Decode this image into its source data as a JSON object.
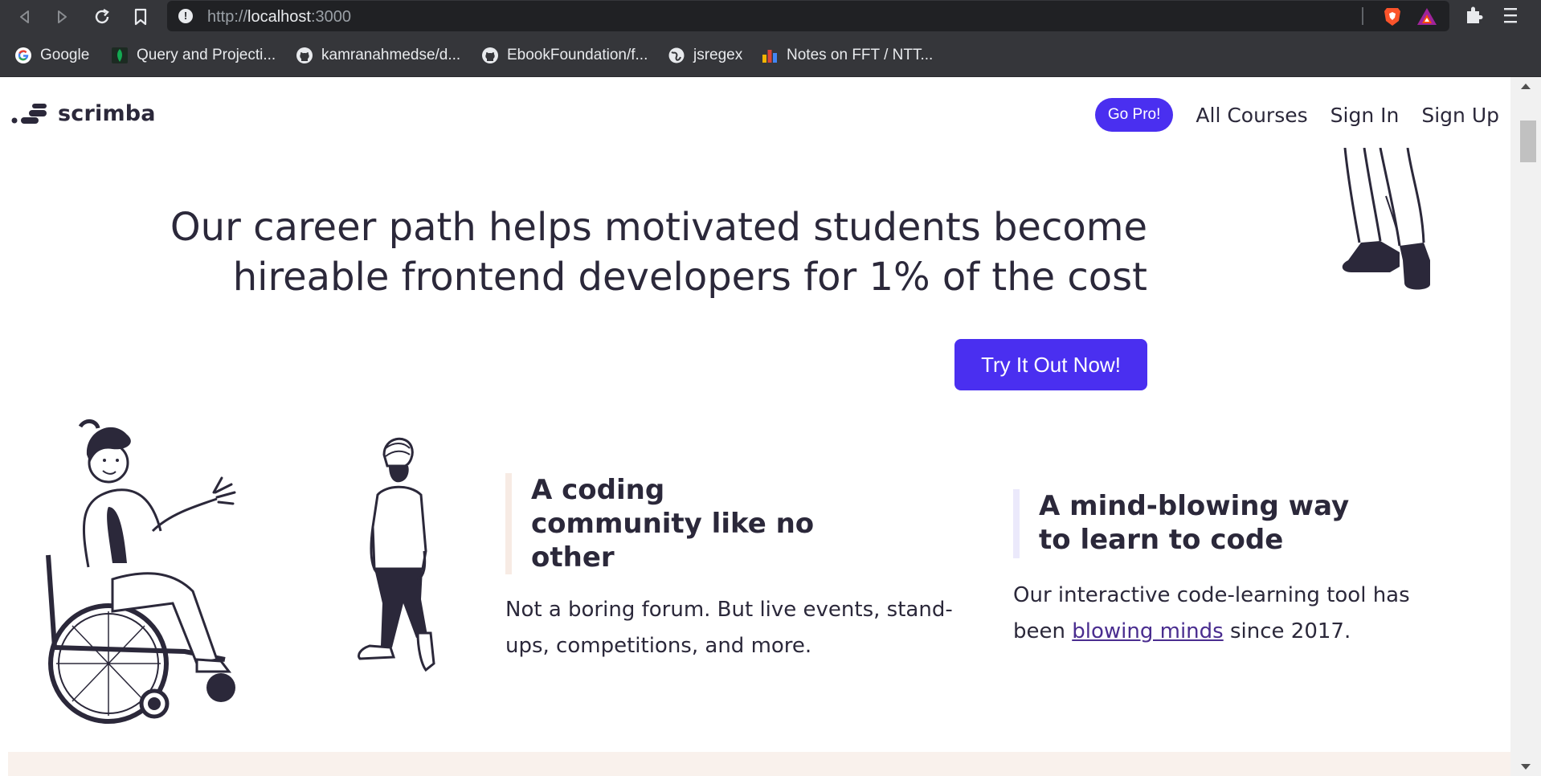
{
  "browser": {
    "url_scheme": "http://",
    "url_host": "localhost",
    "url_port": ":3000",
    "bookmarks": [
      {
        "label": "Google",
        "icon": "google-icon"
      },
      {
        "label": "Query and Projecti...",
        "icon": "mongodb-leaf-icon"
      },
      {
        "label": "kamranahmedse/d...",
        "icon": "github-icon"
      },
      {
        "label": "EbookFoundation/f...",
        "icon": "github-icon"
      },
      {
        "label": "jsregex",
        "icon": "globe-icon"
      },
      {
        "label": "Notes on FFT / NTT...",
        "icon": "bar-chart-icon"
      }
    ]
  },
  "site": {
    "logo_text": "scrimba",
    "nav": {
      "go_pro": "Go Pro!",
      "all_courses": "All Courses",
      "sign_in": "Sign In",
      "sign_up": "Sign Up"
    },
    "hero": {
      "title_line1": "Our career path helps motivated students become",
      "title_line2": "hireable frontend developers for 1% of the cost",
      "cta": "Try It Out Now!"
    },
    "features": [
      {
        "title_lines": [
          "A coding",
          "community like no",
          "other"
        ],
        "text_line1": "Not a boring forum. But live events, stand-",
        "text_line2": "ups, competitions, and more."
      },
      {
        "title_lines": [
          "A mind-blowing way",
          "to learn to code"
        ],
        "text_line1": "Our interactive code-learning tool has",
        "text_line2_before": "been ",
        "text_link": "blowing minds",
        "text_line2_after": " since 2017."
      }
    ]
  },
  "colors": {
    "brand_purple": "#4a2ff0",
    "ink": "#2b283a",
    "feature1_bar": "#f7ebe4",
    "feature2_bar": "#ebe9fb",
    "band": "#f9f1ec"
  }
}
